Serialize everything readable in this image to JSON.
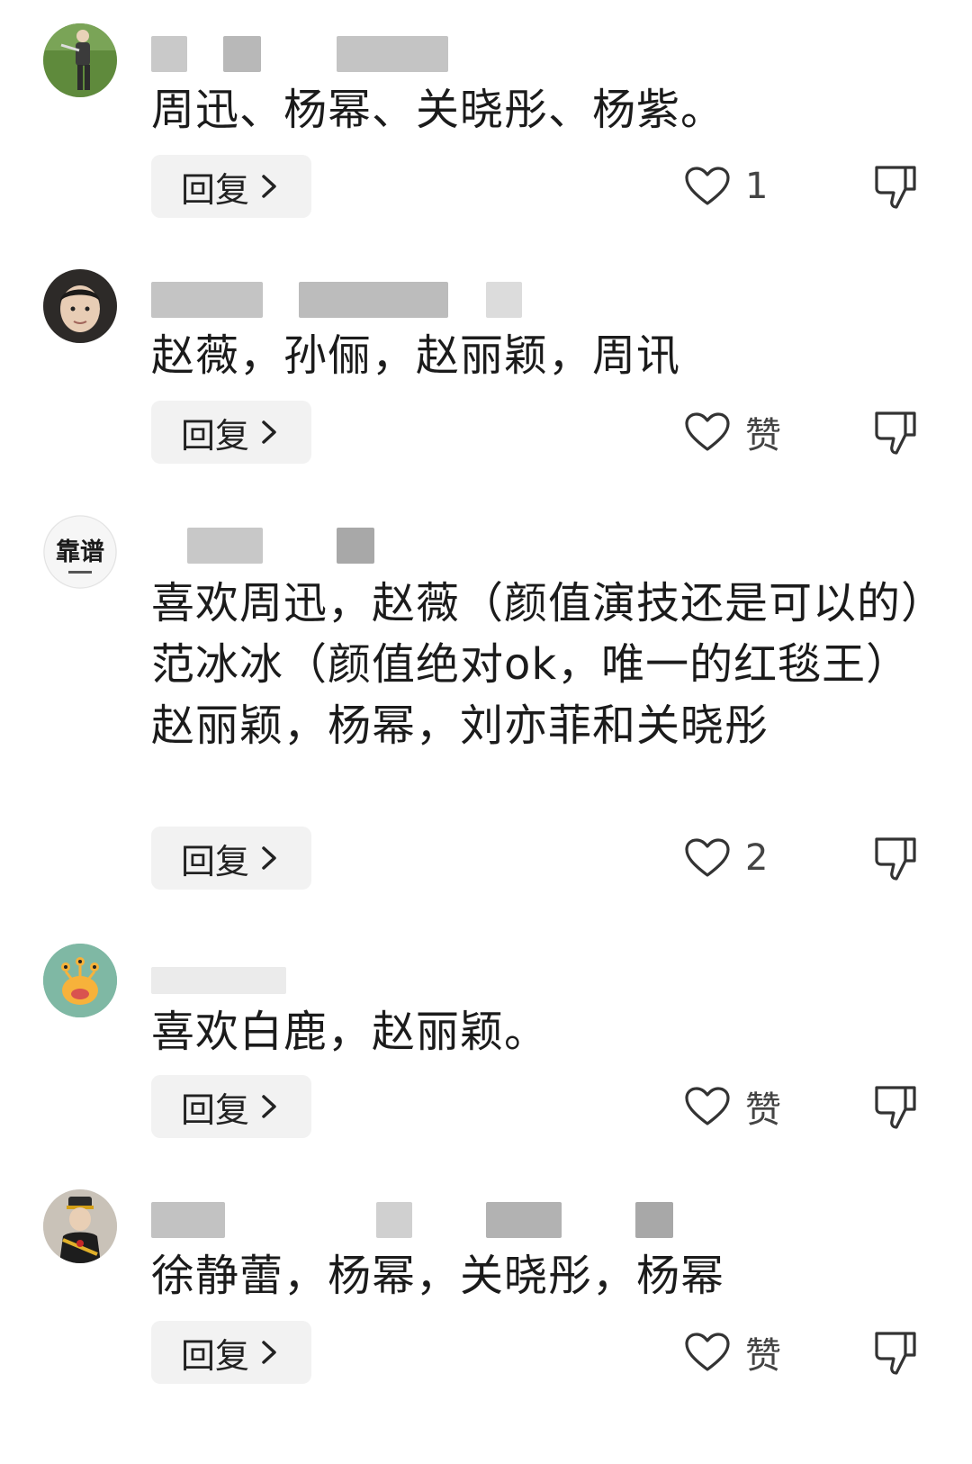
{
  "comments": [
    {
      "text": "周迅、杨幂、关晓彤、杨紫。",
      "reply_label": "回复",
      "like_label": "1",
      "avatar_icon": "golfer-photo-icon"
    },
    {
      "text": "赵薇，孙俪，赵丽颖，周讯",
      "reply_label": "回复",
      "like_label": "赞",
      "avatar_icon": "boy-portrait-icon"
    },
    {
      "text": "喜欢周迅，赵薇（颜值演技还是可以的）范冰冰（颜值绝对ok，唯一的红毯王）赵丽颖，杨幂，刘亦菲和关晓彤",
      "reply_label": "回复",
      "like_label": "2",
      "avatar_icon": "kaopu-logo-icon",
      "avatar_text": "靠谱"
    },
    {
      "text": "喜欢白鹿，赵丽颖。",
      "reply_label": "回复",
      "like_label": "赞",
      "avatar_icon": "cartoon-monster-icon"
    },
    {
      "text": "徐静蕾，杨幂，关晓彤，杨幂",
      "reply_label": "回复",
      "like_label": "赞",
      "avatar_icon": "child-costume-icon"
    }
  ]
}
